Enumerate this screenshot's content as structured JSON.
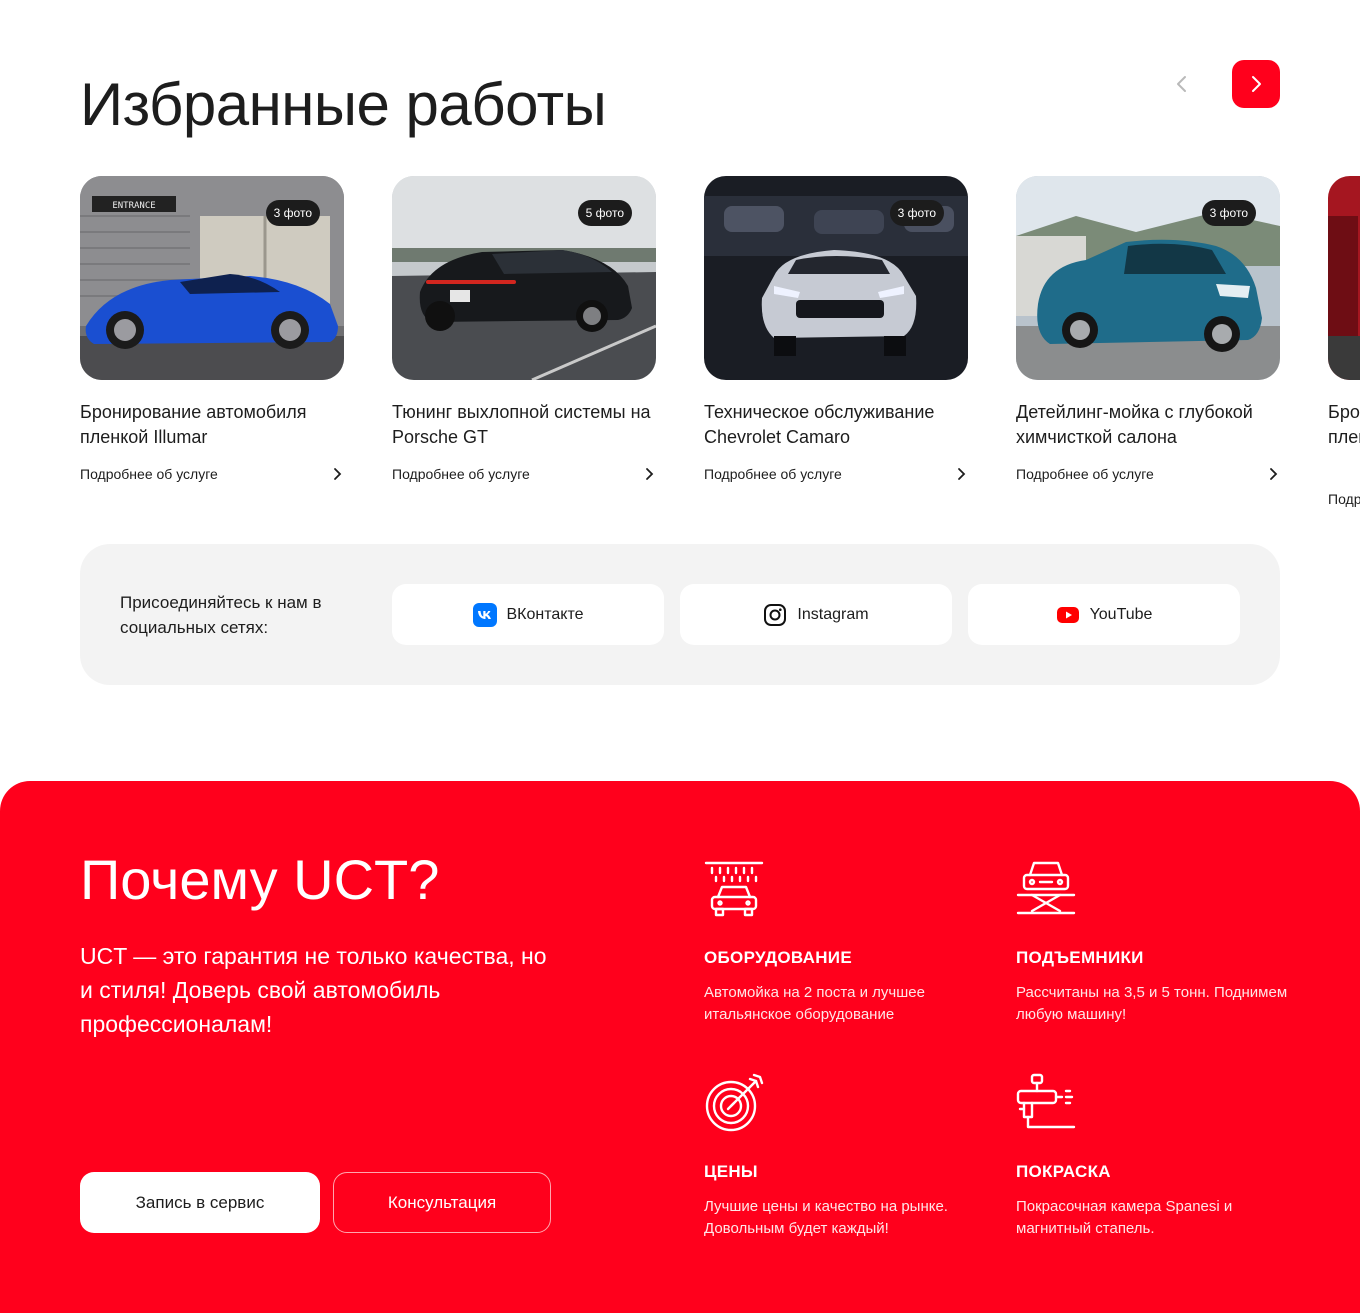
{
  "works": {
    "title": "Избранные работы",
    "more_label": "Подробнее об услуге",
    "items": [
      {
        "title": "Бронирование автомобиля пленкой Illumar",
        "photos": "3 фото",
        "sign": "ENTRANCE"
      },
      {
        "title": "Тюнинг выхлопной системы на Porsche GT",
        "photos": "5 фото"
      },
      {
        "title": "Техническое обслуживание Chevrolet Camaro",
        "photos": "3 фото"
      },
      {
        "title": "Детейлинг-мойка с глубокой химчисткой салона",
        "photos": "3 фото"
      },
      {
        "title": "Бронирование автомобиля пленкой и процессом",
        "photos": "",
        "partial": "Бро пле про",
        "more_partial": "Подр"
      }
    ]
  },
  "social": {
    "text": "Присоединяйтесь к нам в социальных сетях:",
    "buttons": [
      {
        "label": "ВКонтакте",
        "icon": "vk-icon"
      },
      {
        "label": "Instagram",
        "icon": "instagram-icon"
      },
      {
        "label": "YouTube",
        "icon": "youtube-icon"
      }
    ]
  },
  "why": {
    "title": "Почему UCT?",
    "lead": "UCT — это гарантия не только качества, но и стиля! Доверь свой автомобиль профессионалам!",
    "primary_button": "Запись в сервис",
    "secondary_button": "Консультация",
    "features": [
      {
        "title": "ОБОРУДОВАНИЕ",
        "text": "Автомойка на 2 поста и лучшее итальянское оборудование",
        "icon": "car-wash-icon"
      },
      {
        "title": "ПОДЪЕМНИКИ",
        "text": "Рассчитаны на 3,5 и 5 тонн. Поднимем любую машину!",
        "icon": "car-lift-icon"
      },
      {
        "title": "ЦЕНЫ",
        "text": "Лучшие цены и качество на рынке. Довольным будет каждый!",
        "icon": "target-icon"
      },
      {
        "title": "ПОКРАСКА",
        "text": "Покрасочная камера Spanesi и магнитный стапель.",
        "icon": "spray-gun-icon"
      }
    ]
  },
  "colors": {
    "accent": "#ff001c",
    "panel": "#f3f3f3",
    "text": "#1d1d1d"
  }
}
